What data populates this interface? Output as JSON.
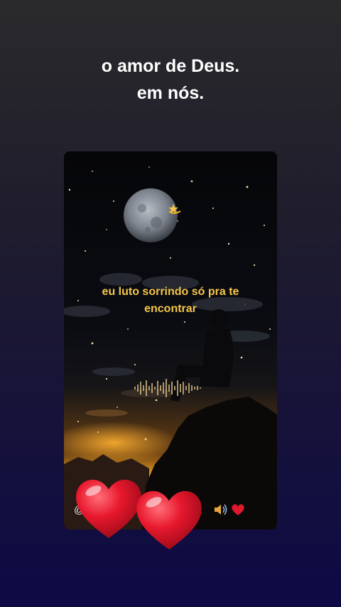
{
  "caption": {
    "line1": "o amor de Deus.",
    "line2": "em nós."
  },
  "video_card": {
    "lyric_line1": "eu luto sorrindo só pra te",
    "lyric_line2": "encontrar",
    "moon_color": "#9aa0a8",
    "sky_color": "#050608",
    "sunset_color": "#f0a020",
    "lyric_color": "#f6c64a"
  },
  "bottom_bar": {
    "at_symbol": "@",
    "icons": [
      "speaker-icon",
      "heart-icon"
    ]
  },
  "overlay": {
    "hearts": [
      "heart-icon",
      "heart-icon"
    ],
    "heart_color": "#e0182d"
  },
  "icons": {
    "shooting_star": "shooting-star-icon",
    "waveform": "audio-waveform-icon"
  }
}
